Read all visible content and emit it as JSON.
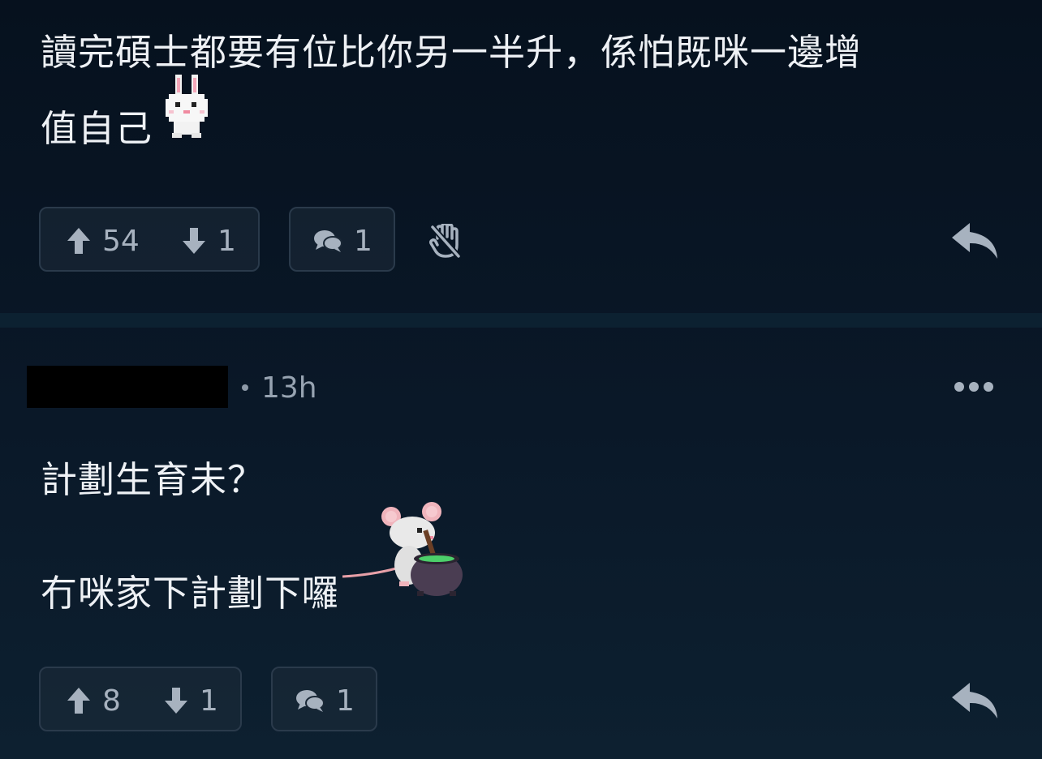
{
  "comments": [
    {
      "body_lines": [
        "讀完碩士都要有位比你另一半升，係怕既咪一邊增",
        "值自己"
      ],
      "sticker": "rabbit-sticker",
      "upvotes": "54",
      "downvotes": "1",
      "replies": "1"
    },
    {
      "time": "13h",
      "body_lines": [
        "計劃生育未？",
        "冇咪家下計劃下囉"
      ],
      "sticker": "mouse-cauldron-sticker",
      "upvotes": "8",
      "downvotes": "1",
      "replies": "1"
    }
  ],
  "icons": {
    "upvote": "arrow-up-icon",
    "downvote": "arrow-down-icon",
    "reply_count": "chat-bubbles-icon",
    "block": "hand-slash-icon",
    "reply": "reply-arrow-icon",
    "more": "more-dots-icon"
  },
  "colors": {
    "background": "#0a1624",
    "text": "#eef1f5",
    "muted": "#a7b2bf",
    "pill_border": "#2a3a4b"
  }
}
